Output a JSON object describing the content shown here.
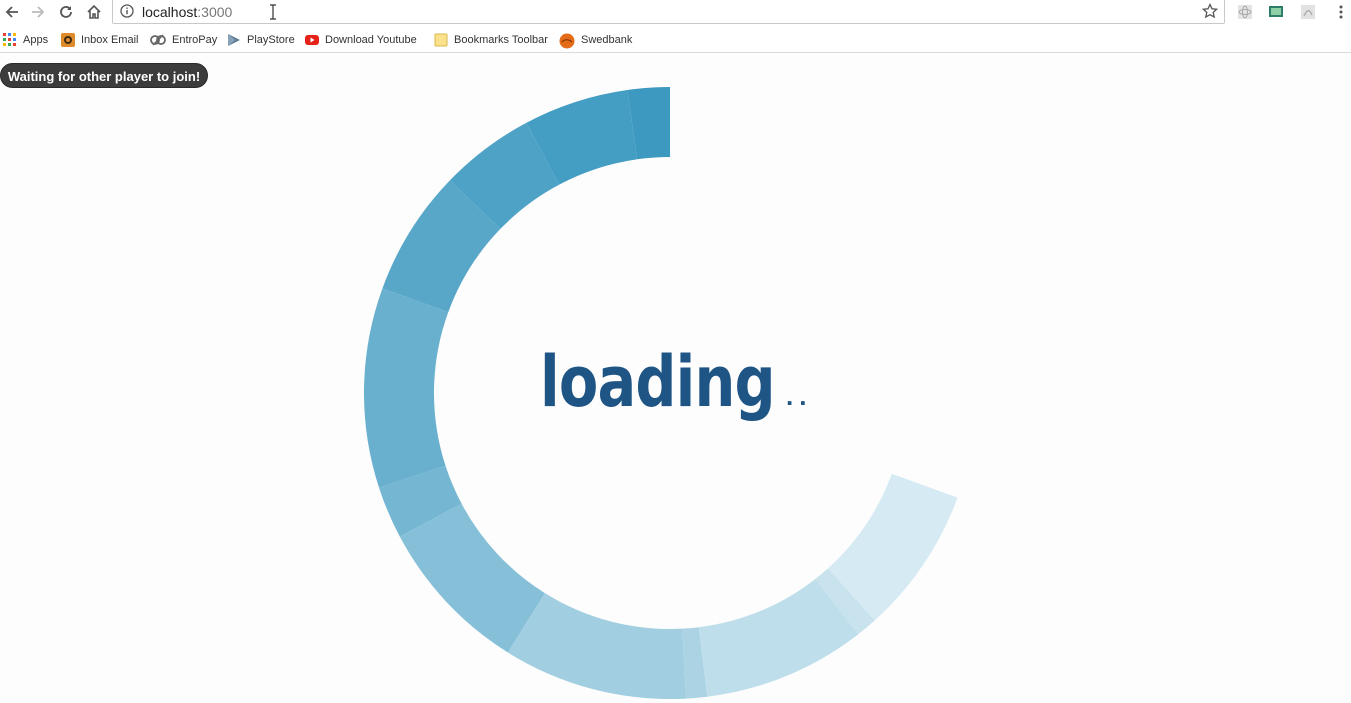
{
  "browser": {
    "url_host": "localhost",
    "url_port": ":3000",
    "bookmarks": [
      {
        "label": "Apps",
        "icon": "apps-grid-icon"
      },
      {
        "label": "Inbox Email",
        "icon": "inbox-email-icon"
      },
      {
        "label": "EntroPay",
        "icon": "entropay-icon"
      },
      {
        "label": "PlayStore",
        "icon": "playstore-icon"
      },
      {
        "label": "Download Youtube",
        "icon": "youtube-icon"
      },
      {
        "label": "Bookmarks Toolbar",
        "icon": "folder-icon"
      },
      {
        "label": "Swedbank",
        "icon": "swedbank-icon"
      }
    ]
  },
  "page": {
    "status": "Waiting for other player to join!",
    "loading_label": "loading",
    "loading_dots": ".."
  },
  "colors": {
    "loader_dark": "#3d99c0",
    "loader_light": "#e3f1f7",
    "loading_text": "#1e5585",
    "pill_bg": "#3c3c3c"
  }
}
